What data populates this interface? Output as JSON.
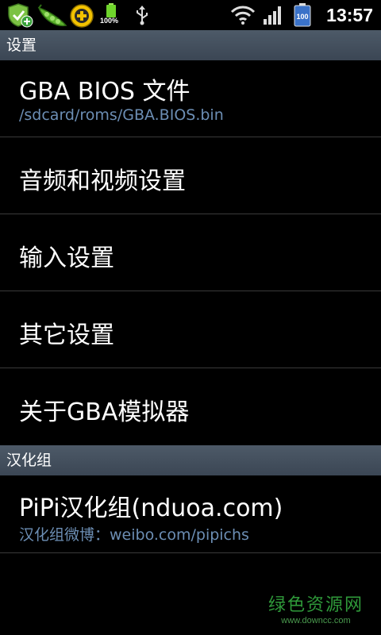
{
  "status_bar": {
    "time": "13:57",
    "battery_percent_label": "100%",
    "battery_badge": "100",
    "icons": [
      "shield-add-icon",
      "pea-pod-icon",
      "plus-circle-icon",
      "battery-icon",
      "usb-icon",
      "wifi-icon",
      "signal-icon",
      "battery-full-icon"
    ]
  },
  "sections": {
    "settings_header": "设置",
    "group_header": "汉化组"
  },
  "items": {
    "bios": {
      "title": "GBA BIOS 文件",
      "summary": "/sdcard/roms/GBA.BIOS.bin"
    },
    "av": {
      "title": "音频和视频设置"
    },
    "input": {
      "title": "输入设置"
    },
    "other": {
      "title": "其它设置"
    },
    "about": {
      "title": "关于GBA模拟器"
    },
    "group": {
      "title": "PiPi汉化组(nduoa.com)",
      "summary": "汉化组微博：weibo.com/pipichs"
    }
  },
  "watermark": {
    "brand": "绿色资源网",
    "url": "www.downcc.com"
  },
  "colors": {
    "header_bg": "#445060",
    "summary_text": "#6c8eb4",
    "divider": "#3a3a3a",
    "watermark_green": "#2f9a3a"
  }
}
